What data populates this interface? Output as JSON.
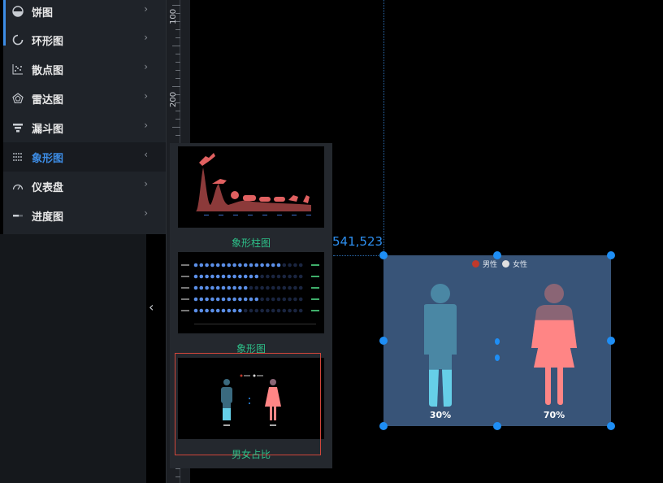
{
  "menu": {
    "items": [
      {
        "label": "饼图",
        "icon": "pie-icon",
        "expanded": false
      },
      {
        "label": "环形图",
        "icon": "ring-icon",
        "expanded": false
      },
      {
        "label": "散点图",
        "icon": "scatter-icon",
        "expanded": false
      },
      {
        "label": "雷达图",
        "icon": "radar-icon",
        "expanded": false
      },
      {
        "label": "漏斗图",
        "icon": "funnel-icon",
        "expanded": false
      },
      {
        "label": "象形图",
        "icon": "pictograph-icon",
        "expanded": true
      },
      {
        "label": "仪表盘",
        "icon": "gauge-icon",
        "expanded": false
      },
      {
        "label": "进度图",
        "icon": "progress-icon",
        "expanded": false
      }
    ],
    "chevron_right": "›",
    "chevron_left": "‹"
  },
  "ruler": {
    "labels": [
      "100",
      "200"
    ]
  },
  "popup": {
    "collapse_glyph": "‹",
    "templates": [
      {
        "title": "象形柱图"
      },
      {
        "title": "象形图"
      },
      {
        "title": "男女占比",
        "selected": true
      }
    ]
  },
  "canvas": {
    "coord_text": "541,523"
  },
  "widget": {
    "legend": [
      {
        "label": "男性",
        "color": "#c0392b"
      },
      {
        "label": "女性",
        "color": "#e0e0e0"
      }
    ],
    "male_percent": "30%",
    "female_percent": "70%",
    "male_fill": 0.3,
    "female_fill": 0.7,
    "colors": {
      "male_light": "#66cfe8",
      "male_dark": "#4a87a4",
      "female_light": "#ff8585",
      "female_dark": "#8a6575",
      "handle": "#1e8ef5",
      "accent": "#3d8de6"
    }
  }
}
